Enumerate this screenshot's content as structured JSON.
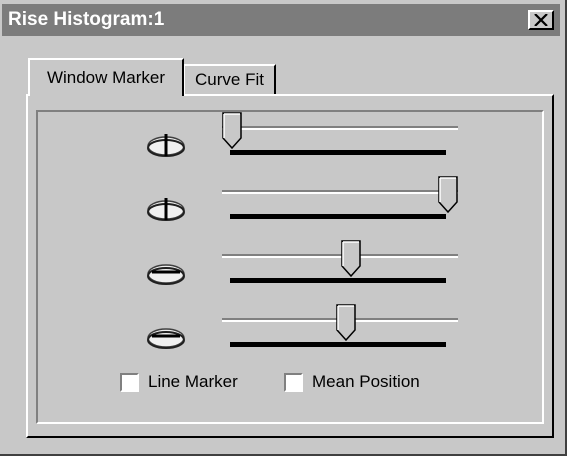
{
  "window": {
    "title": "Rise Histogram:1",
    "close_symbol": "✕"
  },
  "tabs": [
    {
      "label": "Window Marker",
      "active": true
    },
    {
      "label": "Curve Fit",
      "active": false
    }
  ],
  "sliders": [
    {
      "icon": "vertical-marker-icon",
      "level_fraction": 0.0
    },
    {
      "icon": "vertical-marker-icon",
      "level_fraction": 1.0
    },
    {
      "icon": "horizontal-marker-icon",
      "level_fraction": 0.55
    },
    {
      "icon": "horizontal-marker-icon",
      "level_fraction": 0.53
    }
  ],
  "checkboxes": [
    {
      "label": "Line Marker",
      "checked": false
    },
    {
      "label": "Mean Position",
      "checked": false
    }
  ],
  "colors": {
    "window_bg": "#c8c8c8",
    "titlebar_bg": "#7c7c7c",
    "titlebar_text": "#ffffff"
  }
}
